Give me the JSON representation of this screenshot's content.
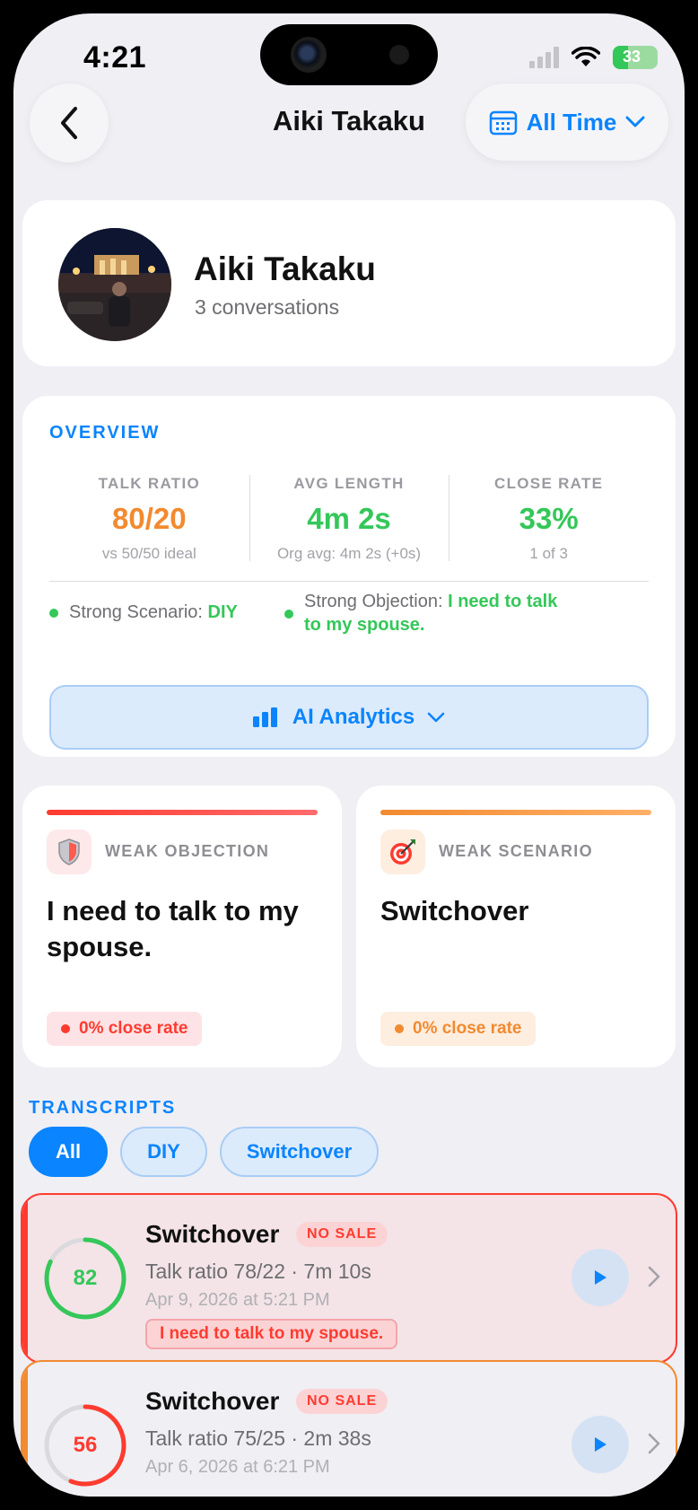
{
  "status_bar": {
    "time": "4:21",
    "battery": "33"
  },
  "nav": {
    "title": "Aiki Takaku",
    "filter_label": "All Time"
  },
  "profile": {
    "name": "Aiki Takaku",
    "conversations": "3 conversations"
  },
  "overview": {
    "label": "OVERVIEW",
    "metrics": [
      {
        "label": "TALK RATIO",
        "value": "80/20",
        "sub": "vs 50/50 ideal",
        "color": "#f28a30"
      },
      {
        "label": "AVG LENGTH",
        "value": "4m 2s",
        "sub": "Org avg: 4m 2s (+0s)",
        "color": "#34c759"
      },
      {
        "label": "CLOSE RATE",
        "value": "33%",
        "sub": "1 of 3",
        "color": "#34c759"
      }
    ],
    "strong_scenario": {
      "label": "Strong Scenario: ",
      "value": "DIY"
    },
    "strong_objection": {
      "label": "Strong Objection: ",
      "value_line1": "I need to talk",
      "value_line2": "to my spouse."
    },
    "ai_button": "AI Analytics"
  },
  "weak": [
    {
      "label": "WEAK OBJECTION",
      "title": "I need to talk to my spouse.",
      "pill": "0% close rate",
      "color": "#ff3b30"
    },
    {
      "label": "WEAK SCENARIO",
      "title": "Switchover",
      "pill": "0% close rate",
      "color": "#f28a30"
    }
  ],
  "transcripts": {
    "label": "TRANSCRIPTS",
    "filters": [
      "All",
      "DIY",
      "Switchover"
    ],
    "active_filter": "All",
    "rows": [
      {
        "score": "82",
        "score_fraction": 0.82,
        "title": "Switchover",
        "badge": "NO SALE",
        "sub": "Talk ratio 78/22 · 7m 10s",
        "date": "Apr 9, 2026 at 5:21 PM",
        "tag": "I need to talk to my spouse.",
        "color": "#ff3b30",
        "ring_color": "#34c759"
      },
      {
        "score": "56",
        "score_fraction": 0.56,
        "title": "Switchover",
        "badge": "NO SALE",
        "sub": "Talk ratio 75/25 · 2m 38s",
        "date": "Apr 6, 2026 at 6:21 PM",
        "color": "#f28a30",
        "ring_color": "#ff3b30"
      }
    ]
  }
}
